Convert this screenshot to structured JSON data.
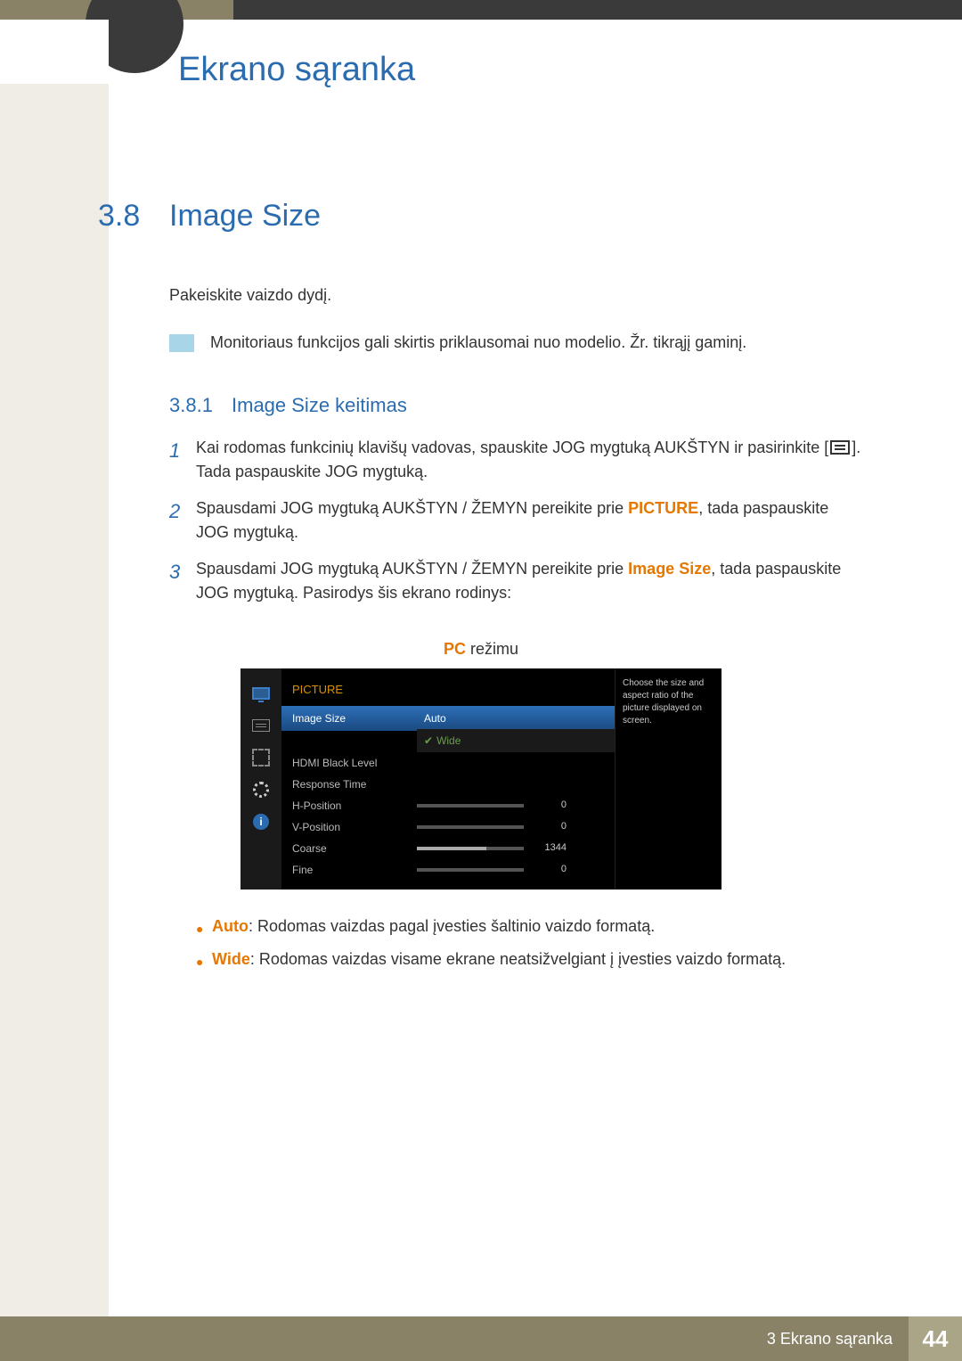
{
  "header": {
    "chapter_title": "Ekrano sąranka"
  },
  "section": {
    "num": "3.8",
    "title": "Image Size",
    "intro": "Pakeiskite vaizdo dydį.",
    "note": "Monitoriaus funkcijos gali skirtis priklausomai nuo modelio. Žr. tikrąjį gaminį."
  },
  "subsection": {
    "num": "3.8.1",
    "title": "Image Size keitimas"
  },
  "steps": {
    "s1_pre": "Kai rodomas funkcinių klavišų vadovas, spauskite JOG mygtuką AUKŠTYN ir pasirinkite [",
    "s1_post": "]. Tada paspauskite JOG mygtuką.",
    "s2_a": "Spausdami JOG mygtuką AUKŠTYN / ŽEMYN pereikite prie ",
    "s2_bold": "PICTURE",
    "s2_b": ", tada paspauskite JOG mygtuką.",
    "s3_a": "Spausdami JOG mygtuką AUKŠTYN / ŽEMYN pereikite prie ",
    "s3_bold": "Image Size",
    "s3_b": ", tada paspauskite JOG mygtuką. Pasirodys šis ekrano rodinys:"
  },
  "mode": {
    "prefix": "PC",
    "suffix": " režimu"
  },
  "osd": {
    "header": "PICTURE",
    "help": "Choose the size and aspect ratio of the picture displayed on screen.",
    "rows": {
      "image_size": {
        "label": "Image Size",
        "value": "Auto"
      },
      "dropdown_wide": "Wide",
      "hdmi": {
        "label": "HDMI Black Level"
      },
      "response": {
        "label": "Response Time"
      },
      "hpos": {
        "label": "H-Position",
        "value": "0",
        "fill": "0%"
      },
      "vpos": {
        "label": "V-Position",
        "value": "0",
        "fill": "0%"
      },
      "coarse": {
        "label": "Coarse",
        "value": "1344",
        "fill": "65%"
      },
      "fine": {
        "label": "Fine",
        "value": "0",
        "fill": "0%"
      }
    },
    "info_char": "i"
  },
  "bullets": {
    "b1_bold": "Auto",
    "b1_text": ": Rodomas vaizdas pagal įvesties šaltinio vaizdo formatą.",
    "b2_bold": "Wide",
    "b2_text": ": Rodomas vaizdas visame ekrane neatsižvelgiant į įvesties vaizdo formatą."
  },
  "footer": {
    "chapter": "3 Ekrano sąranka",
    "page": "44"
  }
}
